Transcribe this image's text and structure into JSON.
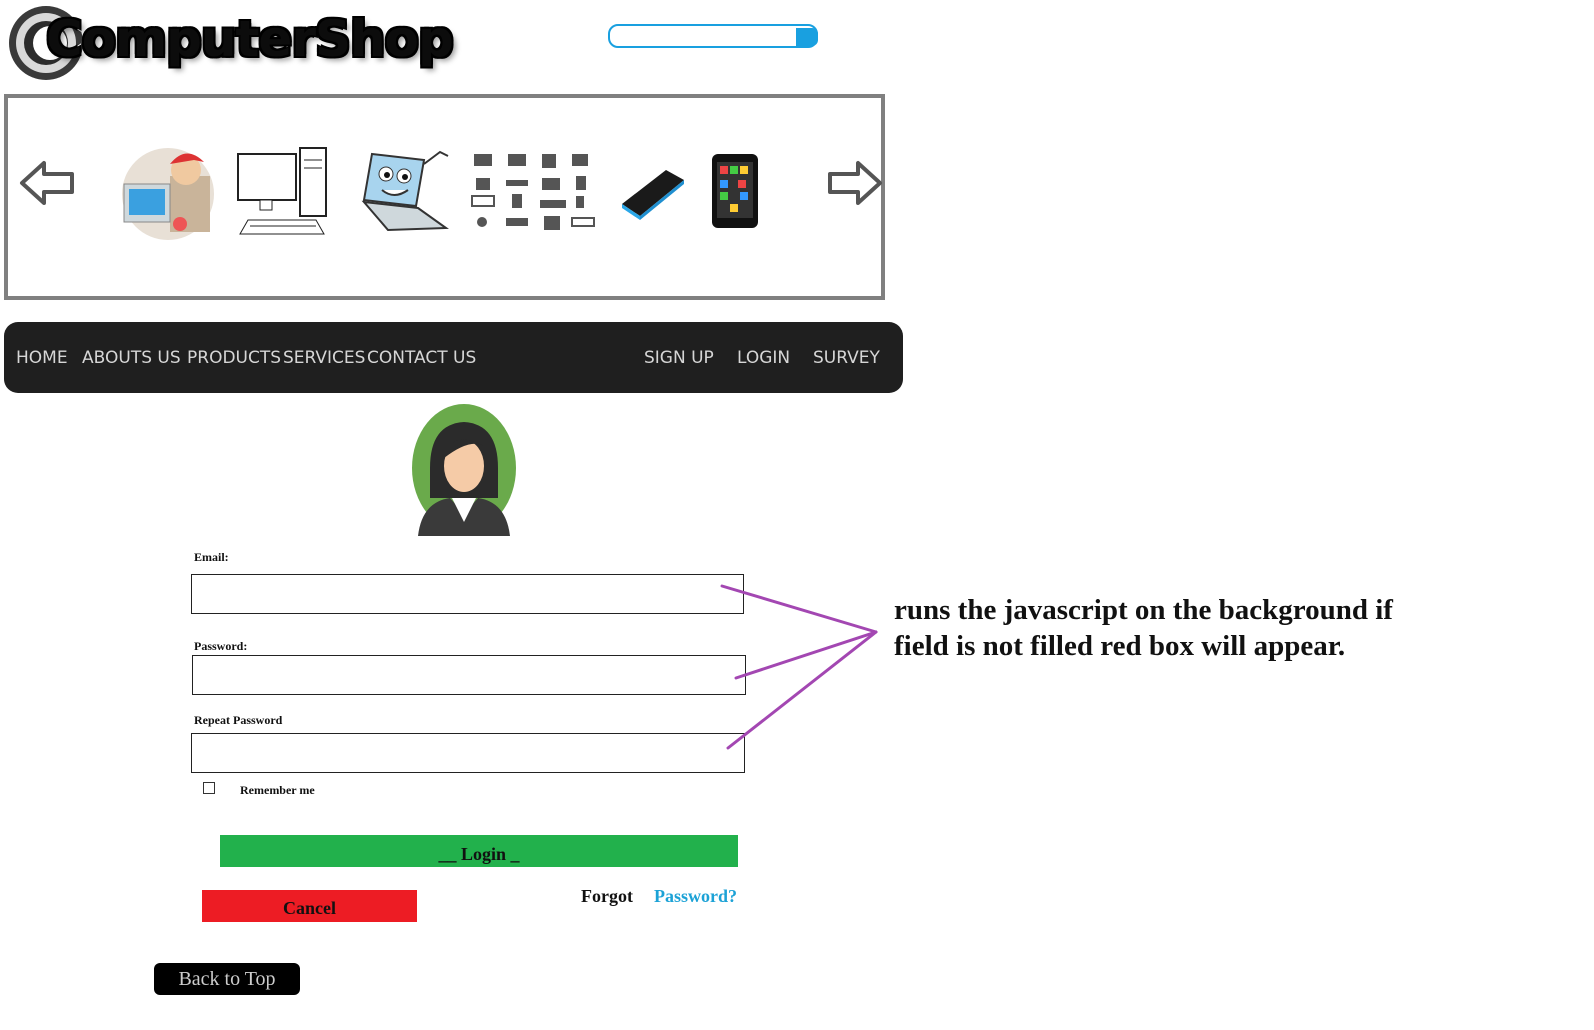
{
  "brand": {
    "logo_text": "ComputerShop"
  },
  "search": {
    "placeholder": ""
  },
  "carousel": {
    "prev_icon": "arrow-left-icon",
    "next_icon": "arrow-right-icon",
    "items": [
      "technician",
      "desktop-computer",
      "laptop-mascot",
      "device-icons",
      "smartphone",
      "tablet-phone"
    ]
  },
  "nav": {
    "left_items": [
      "HOME",
      "ABOUTS US",
      "PRODUCTS",
      "SERVICES",
      "CONTACT US"
    ],
    "right_items": [
      "SIGN UP",
      "LOGIN",
      "SURVEY"
    ]
  },
  "form": {
    "email_label": "Email:",
    "email_value": "",
    "password_label": "Password:",
    "password_value": "",
    "repeat_label": "Repeat Password",
    "repeat_value": "",
    "remember_label": "Remember me",
    "remember_checked": false,
    "login_label": "__ Login _",
    "cancel_label": "Cancel",
    "forgot_text": "Forgot",
    "forgot_link": "Password?"
  },
  "back_to_top": "Back to Top",
  "annotation": "runs the javascript on the background if field is not filled red box will appear.",
  "colors": {
    "nav_bg": "#1f1f1f",
    "login_green": "#22b14c",
    "cancel_red": "#ed1c24",
    "link_blue": "#1ca2d6",
    "annotation_purple": "#a347b2",
    "search_blue": "#19a0e0"
  }
}
